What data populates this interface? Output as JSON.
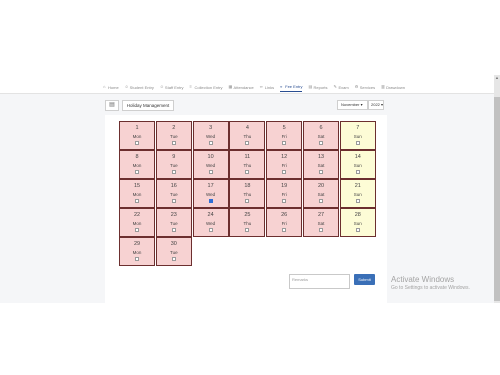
{
  "navbar": {
    "items": [
      {
        "label": "Home",
        "icon": "home-icon"
      },
      {
        "label": "Student Entry",
        "icon": "user-icon"
      },
      {
        "label": "Staff Entry",
        "icon": "user-icon"
      },
      {
        "label": "Collection Entry",
        "icon": "list-icon"
      },
      {
        "label": "Attendance",
        "icon": "calendar-icon"
      },
      {
        "label": "Links",
        "icon": "link-icon"
      },
      {
        "label": "Fee Entry",
        "icon": "money-icon",
        "active": true
      },
      {
        "label": "Reports",
        "icon": "report-icon"
      },
      {
        "label": "Exam",
        "icon": "exam-icon"
      },
      {
        "label": "Services",
        "icon": "gear-icon"
      },
      {
        "label": "Drawdown",
        "icon": "chart-icon"
      }
    ],
    "accent": "#2a4e92"
  },
  "toolbar": {
    "holiday_label": "Holiday Management",
    "calendar_icon": "calendar-icon"
  },
  "filters": {
    "month": "November",
    "year": "2022"
  },
  "calendar": {
    "colors": {
      "weekday": "#f7d2d2",
      "sunday": "#fdfcd6",
      "border": "#6c2f2f"
    },
    "days": [
      {
        "day": "1",
        "weekday": "Mon",
        "checked": false
      },
      {
        "day": "2",
        "weekday": "Tue",
        "checked": false
      },
      {
        "day": "3",
        "weekday": "Wed",
        "checked": false
      },
      {
        "day": "4",
        "weekday": "Thu",
        "checked": false
      },
      {
        "day": "5",
        "weekday": "Fri",
        "checked": false
      },
      {
        "day": "6",
        "weekday": "Sat",
        "checked": false
      },
      {
        "day": "7",
        "weekday": "Sun",
        "checked": false
      },
      {
        "day": "8",
        "weekday": "Mon",
        "checked": false
      },
      {
        "day": "9",
        "weekday": "Tue",
        "checked": false
      },
      {
        "day": "10",
        "weekday": "Wed",
        "checked": false
      },
      {
        "day": "11",
        "weekday": "Thu",
        "checked": false
      },
      {
        "day": "12",
        "weekday": "Fri",
        "checked": false
      },
      {
        "day": "13",
        "weekday": "Sat",
        "checked": false
      },
      {
        "day": "14",
        "weekday": "Sun",
        "checked": false
      },
      {
        "day": "15",
        "weekday": "Mon",
        "checked": false
      },
      {
        "day": "16",
        "weekday": "Tue",
        "checked": false
      },
      {
        "day": "17",
        "weekday": "Wed",
        "checked": true
      },
      {
        "day": "18",
        "weekday": "Thu",
        "checked": false
      },
      {
        "day": "19",
        "weekday": "Fri",
        "checked": false
      },
      {
        "day": "20",
        "weekday": "Sat",
        "checked": false
      },
      {
        "day": "21",
        "weekday": "Sun",
        "checked": false
      },
      {
        "day": "22",
        "weekday": "Mon",
        "checked": false
      },
      {
        "day": "23",
        "weekday": "Tue",
        "checked": false
      },
      {
        "day": "24",
        "weekday": "Wed",
        "checked": false
      },
      {
        "day": "25",
        "weekday": "Thu",
        "checked": false
      },
      {
        "day": "26",
        "weekday": "Fri",
        "checked": false
      },
      {
        "day": "27",
        "weekday": "Sat",
        "checked": false
      },
      {
        "day": "28",
        "weekday": "Sun",
        "checked": false
      },
      {
        "day": "29",
        "weekday": "Mon",
        "checked": false
      },
      {
        "day": "30",
        "weekday": "Tue",
        "checked": false
      }
    ]
  },
  "form": {
    "remarks_placeholder": "Remarks",
    "submit_label": "Submit",
    "submit_color": "#3a6fb7"
  },
  "watermark": {
    "line1": "Activate Windows",
    "line2": "Go to Settings to activate Windows."
  }
}
